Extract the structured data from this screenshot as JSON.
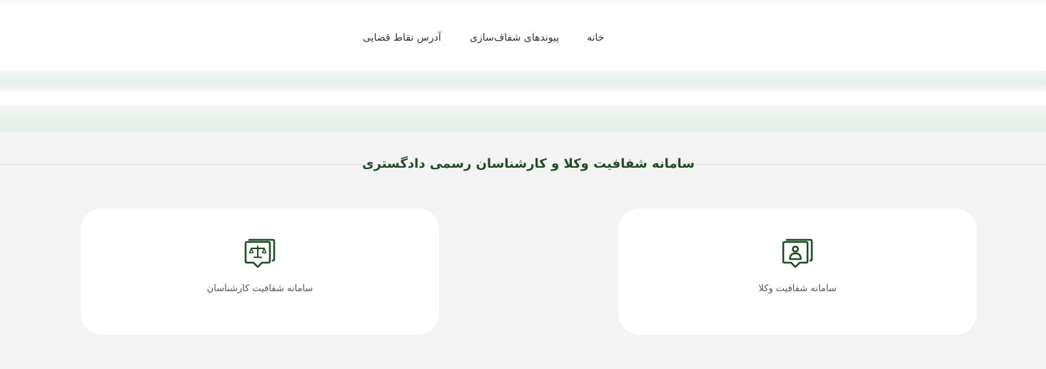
{
  "nav": {
    "items": [
      {
        "label": "خانه"
      },
      {
        "label": "پیوندهای شفاف‌سازی"
      },
      {
        "label": "آدرس نقاط قضایی"
      }
    ]
  },
  "main": {
    "heading": "سامانه شفافیت وکلا و کارشناسان رسمی دادگستری",
    "cards": [
      {
        "label": "سامانه شفافیت وکلا",
        "icon": "lawyer-person-icon"
      },
      {
        "label": "سامانه شفافیت کارشناسان",
        "icon": "scales-of-justice-icon"
      }
    ]
  },
  "colors": {
    "accent": "#1f4d24",
    "background": "#f3f3f3",
    "card": "#ffffff"
  }
}
